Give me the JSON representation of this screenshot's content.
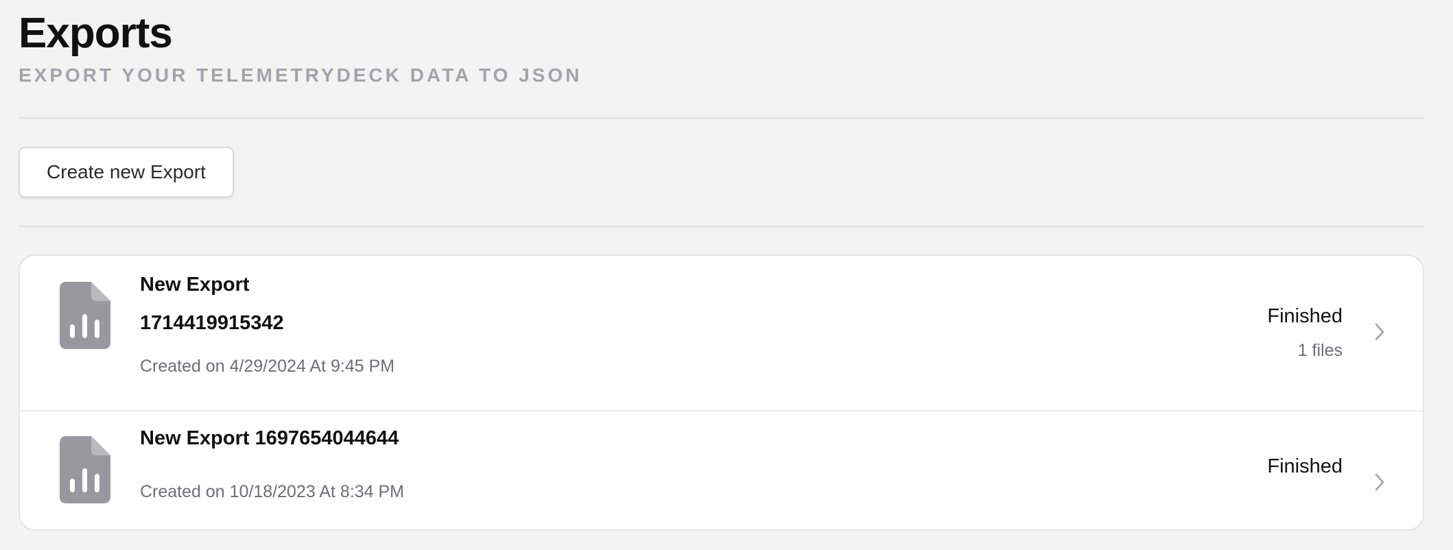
{
  "header": {
    "title": "Exports",
    "subtitle": "EXPORT YOUR TELEMETRYDECK DATA TO JSON"
  },
  "toolbar": {
    "create_label": "Create new Export"
  },
  "exports": [
    {
      "name": "New Export 1714419915342",
      "created": "Created on 4/29/2024 At 9:45 PM",
      "status": "Finished",
      "files": "1 files",
      "icon": "file-chart-icon"
    },
    {
      "name": "New Export 1697654044644",
      "created": "Created on 10/18/2023 At 8:34 PM",
      "status": "Finished",
      "icon": "file-chart-icon"
    }
  ],
  "colors": {
    "background": "#f3f3f3",
    "card": "#ffffff",
    "icon": "#98989e",
    "muted_text": "#6e6e75",
    "subtitle": "#a3a3aa"
  }
}
